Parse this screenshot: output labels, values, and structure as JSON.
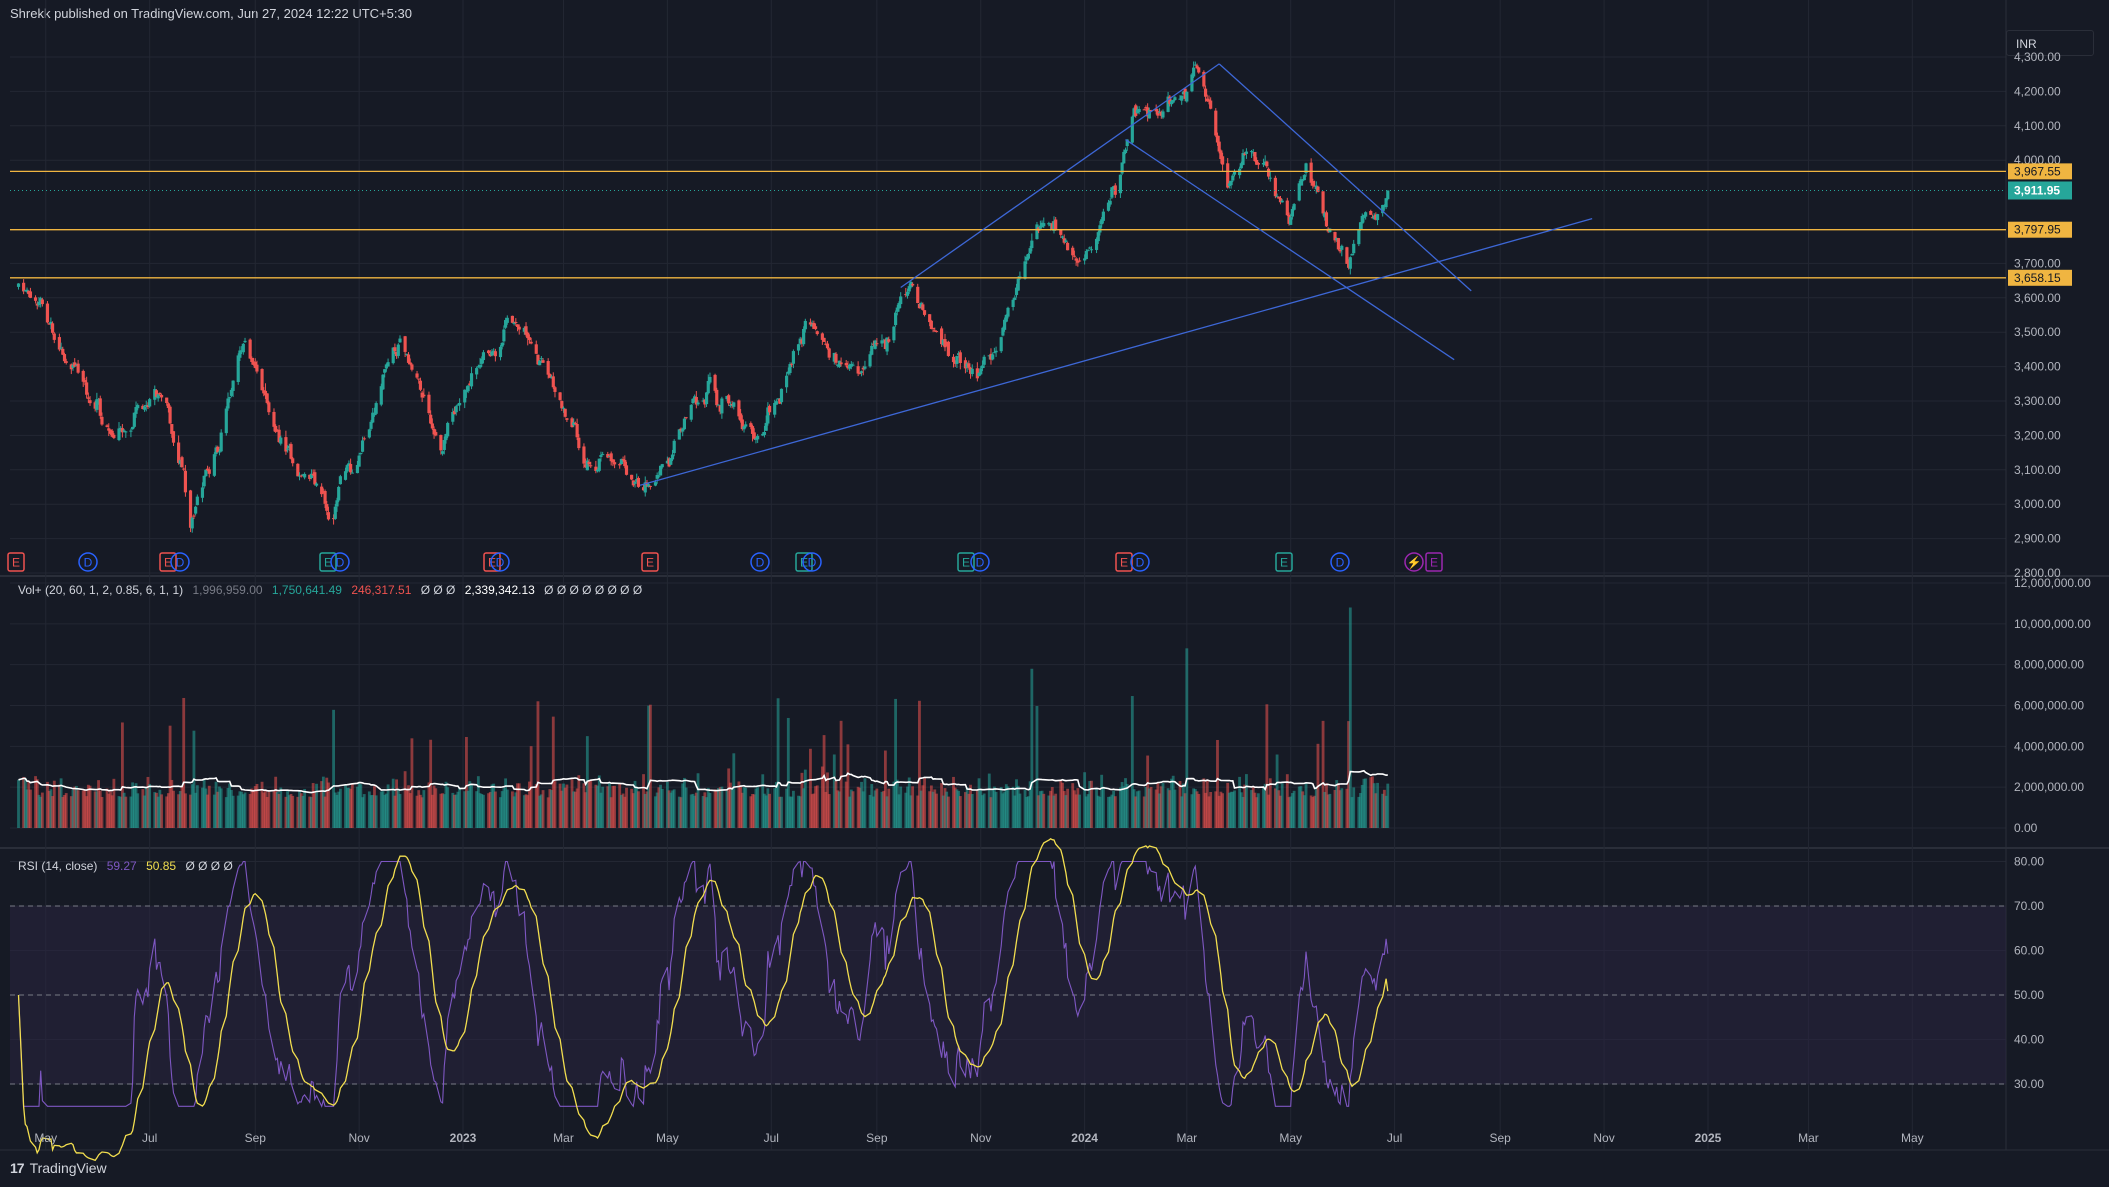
{
  "header": {
    "publisher_line": "Shrekk published on TradingView.com, Jun 27, 2024 12:22 UTC+5:30"
  },
  "currency_label": "INR",
  "footer": {
    "logo_text": "TradingView"
  },
  "colors": {
    "background": "#161a25",
    "grid": "#232733",
    "up": "#26a69a",
    "down": "#ef5350",
    "level_line": "#f0b541",
    "trendline": "#3d67d6",
    "volume_ma": "#ffffff",
    "rsi_line": "#7e57c2",
    "rsi_ma": "#f2de4f",
    "rsi_band": "#2a2540",
    "last_price_bg": "#26a69a"
  },
  "price_panel": {
    "y_ticks": [
      "4,300.00",
      "4,200.00",
      "4,100.00",
      "4,000.00",
      "3,700.00",
      "3,600.00",
      "3,500.00",
      "3,400.00",
      "3,300.00",
      "3,200.00",
      "3,100.00",
      "3,000.00",
      "2,900.00",
      "2,800.00"
    ],
    "y_tick_values": [
      4300,
      4200,
      4100,
      4000,
      3700,
      3600,
      3500,
      3400,
      3300,
      3200,
      3100,
      3000,
      2900,
      2800
    ],
    "levels": [
      {
        "value": 3967.55,
        "label": "3,967.55"
      },
      {
        "value": 3797.95,
        "label": "3,797.95"
      },
      {
        "value": 3658.15,
        "label": "3,658.15"
      }
    ],
    "last_price": {
      "value": 3911.95,
      "label": "3,911.95"
    },
    "event_markers": [
      {
        "text": "E",
        "kind": "earnings-down"
      },
      {
        "text": "D",
        "kind": "dividend"
      },
      {
        "text": "E",
        "kind": "earnings-down"
      },
      {
        "text": "D",
        "kind": "dividend"
      },
      {
        "text": "E",
        "kind": "earnings-up"
      },
      {
        "text": "D",
        "kind": "dividend"
      },
      {
        "text": "E",
        "kind": "earnings-down"
      },
      {
        "text": "D",
        "kind": "dividend"
      },
      {
        "text": "E",
        "kind": "earnings-down"
      },
      {
        "text": "D",
        "kind": "dividend"
      },
      {
        "text": "E",
        "kind": "earnings-up"
      },
      {
        "text": "D",
        "kind": "dividend"
      },
      {
        "text": "E",
        "kind": "earnings-up"
      },
      {
        "text": "D",
        "kind": "dividend"
      },
      {
        "text": "E",
        "kind": "earnings-down"
      },
      {
        "text": "D",
        "kind": "dividend"
      },
      {
        "text": "E",
        "kind": "earnings-up"
      },
      {
        "text": "D",
        "kind": "dividend"
      },
      {
        "text": "⚡",
        "kind": "split"
      },
      {
        "text": "E",
        "kind": "earnings-future"
      }
    ]
  },
  "volume_panel": {
    "legend": {
      "name": "Vol+ (20, 60, 1, 2, 0.85, 6, 1, 1)",
      "v1": "1,996,959.00",
      "v2": "1,750,641.49",
      "v3": "246,317.51",
      "nulls1": "Ø Ø Ø",
      "v4": "2,339,342.13",
      "nulls2": "Ø Ø Ø Ø Ø Ø Ø Ø"
    },
    "y_ticks": [
      "12,000,000.00",
      "10,000,000.00",
      "8,000,000.00",
      "6,000,000.00",
      "4,000,000.00",
      "2,000,000.00",
      "0.00"
    ],
    "y_tick_values": [
      12000000,
      10000000,
      8000000,
      6000000,
      4000000,
      2000000,
      0
    ]
  },
  "rsi_panel": {
    "legend": {
      "name": "RSI (14, close)",
      "rsi": "59.27",
      "ma": "50.85",
      "nulls": "Ø Ø Ø Ø"
    },
    "y_ticks": [
      "80.00",
      "70.00",
      "60.00",
      "50.00",
      "40.00",
      "30.00"
    ],
    "y_tick_values": [
      80,
      70,
      60,
      50,
      40,
      30
    ]
  },
  "x_axis": {
    "ticks": [
      "May",
      "Jul",
      "Sep",
      "Nov",
      "2023",
      "Mar",
      "May",
      "Jul",
      "Sep",
      "Nov",
      "2024",
      "Mar",
      "May",
      "Jul",
      "Sep",
      "Nov",
      "2025",
      "Mar",
      "May"
    ]
  },
  "chart_data": {
    "type": "candlestick",
    "title": "",
    "instrument_currency": "INR",
    "x_range": [
      "2022-04",
      "2025-05"
    ],
    "price_ylim": [
      2800,
      4300
    ],
    "price_keypoints": [
      {
        "date": "2022-04-15",
        "close": 3650
      },
      {
        "date": "2022-05-10",
        "close": 3450
      },
      {
        "date": "2022-06-10",
        "close": 3200
      },
      {
        "date": "2022-07-10",
        "close": 3300
      },
      {
        "date": "2022-07-25",
        "close": 2970
      },
      {
        "date": "2022-08-25",
        "close": 3420
      },
      {
        "date": "2022-09-25",
        "close": 3100
      },
      {
        "date": "2022-10-15",
        "close": 2980
      },
      {
        "date": "2022-11-25",
        "close": 3450
      },
      {
        "date": "2022-12-20",
        "close": 3200
      },
      {
        "date": "2023-02-01",
        "close": 3550
      },
      {
        "date": "2023-03-20",
        "close": 3100
      },
      {
        "date": "2023-04-20",
        "close": 3080
      },
      {
        "date": "2023-05-25",
        "close": 3350
      },
      {
        "date": "2023-06-25",
        "close": 3200
      },
      {
        "date": "2023-07-20",
        "close": 3500
      },
      {
        "date": "2023-08-25",
        "close": 3370
      },
      {
        "date": "2023-09-20",
        "close": 3620
      },
      {
        "date": "2023-10-30",
        "close": 3330
      },
      {
        "date": "2023-11-25",
        "close": 3650
      },
      {
        "date": "2023-12-10",
        "close": 3850
      },
      {
        "date": "2023-12-28",
        "close": 3700
      },
      {
        "date": "2024-01-20",
        "close": 3900
      },
      {
        "date": "2024-02-01",
        "close": 4150
      },
      {
        "date": "2024-03-10",
        "close": 4250
      },
      {
        "date": "2024-03-25",
        "close": 3950
      },
      {
        "date": "2024-04-15",
        "close": 4010
      },
      {
        "date": "2024-04-30",
        "close": 3800
      },
      {
        "date": "2024-05-10",
        "close": 3960
      },
      {
        "date": "2024-06-04",
        "close": 3640
      },
      {
        "date": "2024-06-15",
        "close": 3880
      },
      {
        "date": "2024-06-22",
        "close": 3800
      },
      {
        "date": "2024-06-27",
        "close": 3911.95
      }
    ],
    "horizontal_levels": [
      3967.55,
      3797.95,
      3658.15
    ],
    "trendlines": [
      {
        "from": {
          "date": "2023-04-15",
          "price": 3055
        },
        "to": {
          "date": "2024-10-25",
          "price": 3830
        }
      },
      {
        "from": {
          "date": "2023-09-15",
          "price": 3630
        },
        "to": {
          "date": "2024-03-20",
          "price": 4280
        }
      },
      {
        "from": {
          "date": "2024-03-20",
          "price": 4280
        },
        "to": {
          "date": "2024-08-15",
          "price": 3620
        }
      },
      {
        "from": {
          "date": "2024-01-25",
          "price": 4060
        },
        "to": {
          "date": "2024-08-05",
          "price": 3420
        }
      }
    ],
    "volume_ylim": [
      0,
      12000000
    ],
    "volume_keypoints": [
      {
        "date": "2023-12-01",
        "volume": 7800000
      },
      {
        "date": "2024-03-01",
        "volume": 8800000
      },
      {
        "date": "2024-06-05",
        "volume": 10800000
      }
    ],
    "rsi_ylim": [
      25,
      80
    ],
    "rsi_band": [
      30,
      70
    ],
    "rsi_last": 59.27,
    "rsi_ma_last": 50.85
  }
}
